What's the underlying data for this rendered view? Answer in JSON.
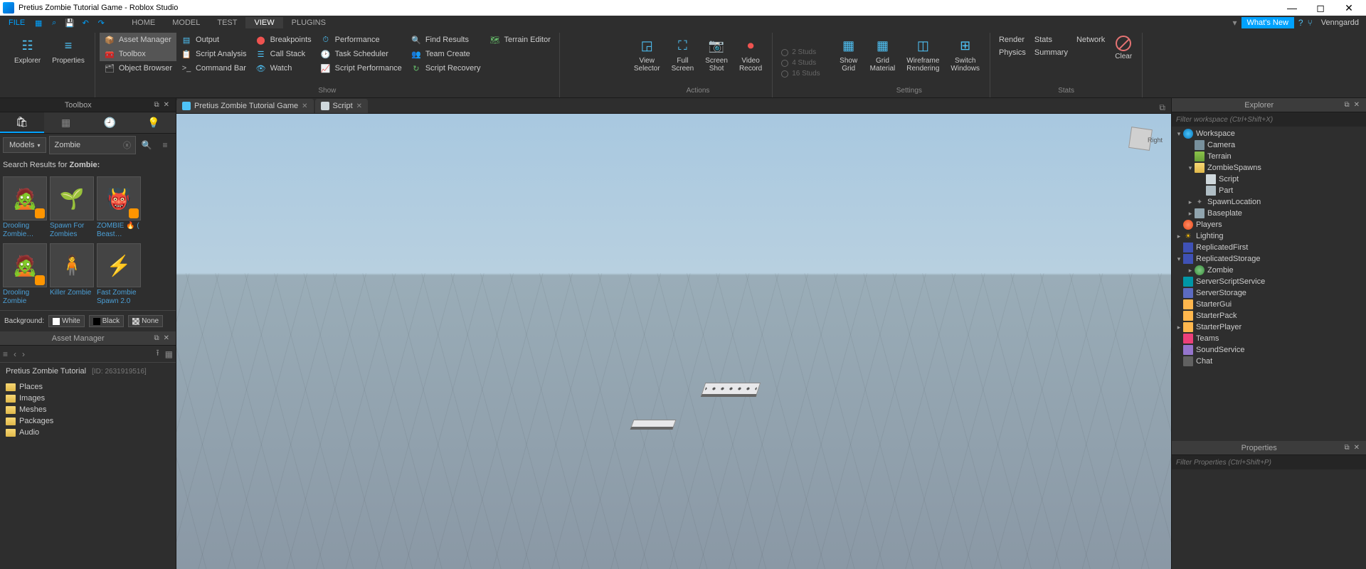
{
  "window": {
    "title": "Pretius Zombie Tutorial Game - Roblox Studio"
  },
  "menubar": {
    "file": "FILE",
    "tabs": [
      "HOME",
      "MODEL",
      "TEST",
      "VIEW",
      "PLUGINS"
    ],
    "active_tab": "VIEW",
    "whats_new": "What's New",
    "username": "Venngardd"
  },
  "ribbon": {
    "explorer": "Explorer",
    "properties": "Properties",
    "show_group": "Show",
    "show_items": [
      {
        "label": "Asset Manager",
        "active": true
      },
      {
        "label": "Toolbox",
        "active": true
      },
      {
        "label": "Object Browser",
        "active": false
      },
      {
        "label": "Output",
        "active": false
      },
      {
        "label": "Script Analysis",
        "active": false
      },
      {
        "label": "Command Bar",
        "active": false
      },
      {
        "label": "Breakpoints",
        "active": false
      },
      {
        "label": "Call Stack",
        "active": false
      },
      {
        "label": "Watch",
        "active": false
      },
      {
        "label": "Performance",
        "active": false
      },
      {
        "label": "Task Scheduler",
        "active": false
      },
      {
        "label": "Script Performance",
        "active": false
      },
      {
        "label": "Find Results",
        "active": false
      },
      {
        "label": "Team Create",
        "active": false
      },
      {
        "label": "Script Recovery",
        "active": false
      },
      {
        "label": "Terrain Editor",
        "active": false
      }
    ],
    "actions_group": "Actions",
    "actions": [
      {
        "label": "View\nSelector"
      },
      {
        "label": "Full\nScreen"
      },
      {
        "label": "Screen\nShot"
      },
      {
        "label": "Video\nRecord"
      }
    ],
    "studs": [
      "2 Studs",
      "4 Studs",
      "16 Studs"
    ],
    "settings_group": "Settings",
    "settings": [
      {
        "label": "Show\nGrid"
      },
      {
        "label": "Grid\nMaterial"
      },
      {
        "label": "Wireframe\nRendering"
      },
      {
        "label": "Switch\nWindows"
      }
    ],
    "stats_group": "Stats",
    "stats_left": [
      "Render",
      "Physics"
    ],
    "stats_mid": [
      "Stats",
      "Summary"
    ],
    "stats_right": "Network",
    "clear": "Clear"
  },
  "toolbox": {
    "title": "Toolbox",
    "category": "Models",
    "search_value": "Zombie",
    "results_label": "Search Results for",
    "results_term": "Zombie:",
    "background_label": "Background:",
    "bg_options": [
      "White",
      "Black",
      "None"
    ],
    "items": [
      {
        "name": "Drooling Zombie…",
        "badge": true,
        "emoji": "🧟"
      },
      {
        "name": "Spawn For Zombies",
        "badge": false,
        "emoji": "🌱"
      },
      {
        "name": "ZOMBIE 🔥 ( Beast…",
        "badge": true,
        "emoji": "👹"
      },
      {
        "name": "Drooling Zombie",
        "badge": true,
        "emoji": "🧟"
      },
      {
        "name": "Killer Zombie",
        "badge": false,
        "emoji": "🧍"
      },
      {
        "name": "Fast Zombie Spawn 2.0",
        "badge": false,
        "emoji": "⚡"
      }
    ]
  },
  "asset_manager": {
    "title": "Asset Manager",
    "project": "Pretius Zombie Tutorial",
    "project_id": "[ID: 2631919516]",
    "folders": [
      "Places",
      "Images",
      "Meshes",
      "Packages",
      "Audio"
    ]
  },
  "doctabs": [
    {
      "label": "Pretius Zombie Tutorial Game",
      "icon": "#4fc3f7"
    },
    {
      "label": "Script",
      "icon": "#cfd8dc"
    }
  ],
  "viewport": {
    "gizmo_label": "Right"
  },
  "explorer": {
    "title": "Explorer",
    "filter_placeholder": "Filter workspace (Ctrl+Shift+X)",
    "tree": [
      {
        "d": 0,
        "arr": "▾",
        "ico": "i-globe",
        "label": "Workspace"
      },
      {
        "d": 1,
        "arr": "",
        "ico": "i-cam",
        "label": "Camera"
      },
      {
        "d": 1,
        "arr": "",
        "ico": "i-terr",
        "label": "Terrain"
      },
      {
        "d": 1,
        "arr": "▾",
        "ico": "i-fold",
        "label": "ZombieSpawns"
      },
      {
        "d": 2,
        "arr": "",
        "ico": "i-script",
        "label": "Script"
      },
      {
        "d": 2,
        "arr": "",
        "ico": "i-part",
        "label": "Part"
      },
      {
        "d": 1,
        "arr": "▸",
        "ico": "i-spawn",
        "label": "SpawnLocation",
        "txt": "✦"
      },
      {
        "d": 1,
        "arr": "▸",
        "ico": "i-base",
        "label": "Baseplate"
      },
      {
        "d": 0,
        "arr": "",
        "ico": "i-players",
        "label": "Players"
      },
      {
        "d": 0,
        "arr": "▸",
        "ico": "i-light",
        "label": "Lighting",
        "txt": "☀"
      },
      {
        "d": 0,
        "arr": "",
        "ico": "i-rep",
        "label": "ReplicatedFirst"
      },
      {
        "d": 0,
        "arr": "▾",
        "ico": "i-rep",
        "label": "ReplicatedStorage"
      },
      {
        "d": 1,
        "arr": "▸",
        "ico": "i-zombie",
        "label": "Zombie"
      },
      {
        "d": 0,
        "arr": "",
        "ico": "i-srv",
        "label": "ServerScriptService"
      },
      {
        "d": 0,
        "arr": "",
        "ico": "i-store",
        "label": "ServerStorage"
      },
      {
        "d": 0,
        "arr": "",
        "ico": "i-gui",
        "label": "StarterGui"
      },
      {
        "d": 0,
        "arr": "",
        "ico": "i-gui",
        "label": "StarterPack"
      },
      {
        "d": 0,
        "arr": "▸",
        "ico": "i-gui",
        "label": "StarterPlayer"
      },
      {
        "d": 0,
        "arr": "",
        "ico": "i-team",
        "label": "Teams"
      },
      {
        "d": 0,
        "arr": "",
        "ico": "i-sound",
        "label": "SoundService"
      },
      {
        "d": 0,
        "arr": "",
        "ico": "i-chat",
        "label": "Chat"
      }
    ]
  },
  "properties": {
    "title": "Properties",
    "filter_placeholder": "Filter Properties (Ctrl+Shift+P)"
  }
}
